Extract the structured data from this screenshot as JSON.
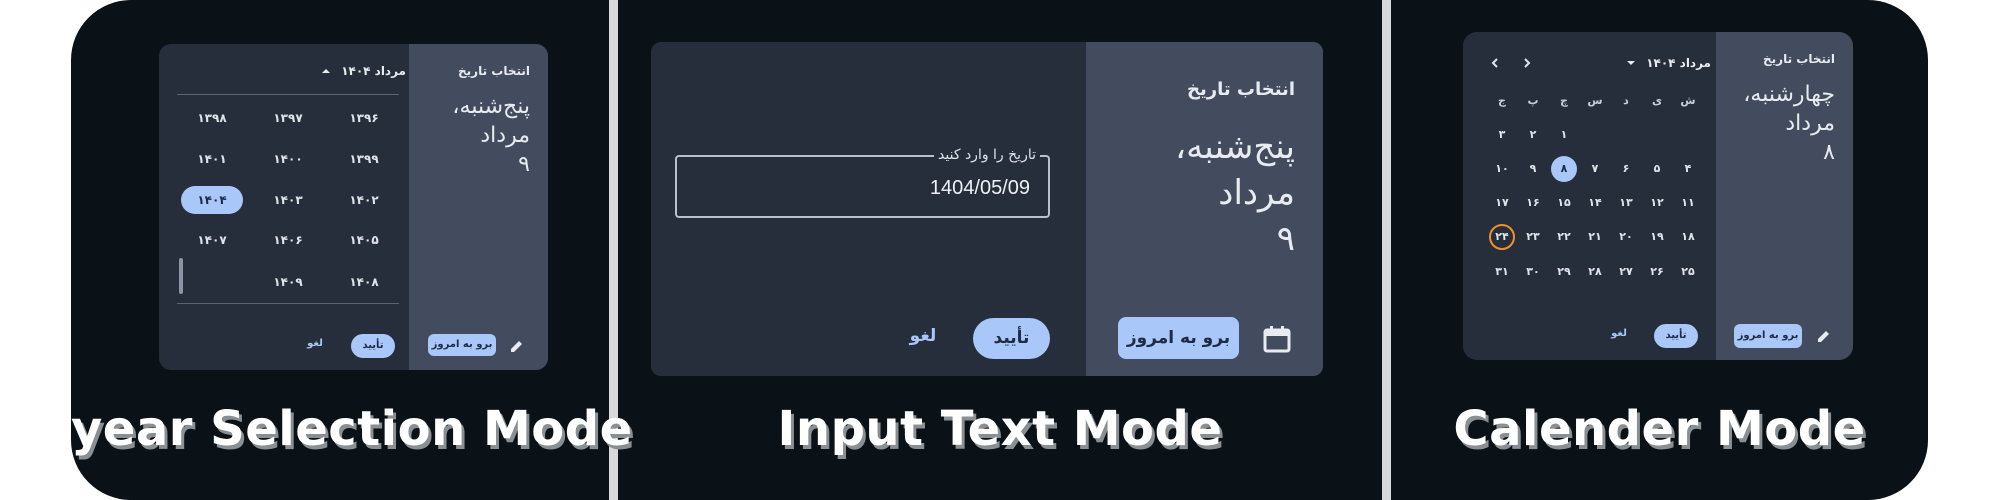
{
  "colors": {
    "frame": "#0a1218",
    "card": "#272e3b",
    "side_panel": "#434c5e",
    "accent": "#a9c7f8",
    "today_ring": "#f0902a"
  },
  "year_mode": {
    "caption": "year Selection Mode",
    "title": "انتخاب تاریخ",
    "date_lines": [
      "پنج‌شنبه،",
      "مرداد",
      "۹"
    ],
    "header_label": "مرداد ۱۴۰۴",
    "header_icon": "caret-up-icon",
    "years": [
      [
        "۱۳۹۶",
        "۱۳۹۷",
        "۱۳۹۸"
      ],
      [
        "۱۳۹۹",
        "۱۴۰۰",
        "۱۴۰۱"
      ],
      [
        "۱۴۰۲",
        "۱۴۰۳",
        "۱۴۰۴"
      ],
      [
        "۱۴۰۵",
        "۱۴۰۶",
        "۱۴۰۷"
      ],
      [
        "۱۴۰۸",
        "۱۴۰۹",
        ""
      ]
    ],
    "selected_year": "۱۴۰۴",
    "today_button": "برو به امروز",
    "ok_button": "تأیید",
    "cancel_button": "لغو",
    "edit_icon": "pencil-icon"
  },
  "input_mode": {
    "caption": "Input Text Mode",
    "title": "انتخاب تاریخ",
    "date_lines": [
      "پنج‌شنبه،",
      "مرداد",
      "۹"
    ],
    "field_label": "تاریخ را وارد کنید",
    "field_value": "1404/05/09",
    "today_button": "برو به امروز",
    "ok_button": "تأیید",
    "cancel_button": "لغو",
    "calendar_icon": "calendar-icon"
  },
  "calendar_mode": {
    "caption": "Calender Mode",
    "title": "انتخاب تاریخ",
    "date_lines": [
      "چهارشنبه،",
      "مرداد",
      "۸"
    ],
    "header_label": "مرداد ۱۴۰۴",
    "header_icon": "caret-down-icon",
    "nav_prev_icon": "chevron-left-icon",
    "nav_next_icon": "chevron-right-icon",
    "weekdays": [
      "ش",
      "ی",
      "د",
      "س",
      "چ",
      "پ",
      "ج"
    ],
    "weeks": [
      [
        "",
        "",
        "",
        "",
        "۱",
        "۲",
        "۳"
      ],
      [
        "۴",
        "۵",
        "۶",
        "۷",
        "۸",
        "۹",
        "۱۰"
      ],
      [
        "۱۱",
        "۱۲",
        "۱۳",
        "۱۴",
        "۱۵",
        "۱۶",
        "۱۷"
      ],
      [
        "۱۸",
        "۱۹",
        "۲۰",
        "۲۱",
        "۲۲",
        "۲۳",
        "۲۴"
      ],
      [
        "۲۵",
        "۲۶",
        "۲۷",
        "۲۸",
        "۲۹",
        "۳۰",
        "۳۱"
      ]
    ],
    "selected_day": "۸",
    "today_day": "۲۴",
    "today_button": "برو به امروز",
    "ok_button": "تأیید",
    "cancel_button": "لغو",
    "edit_icon": "pencil-icon"
  }
}
